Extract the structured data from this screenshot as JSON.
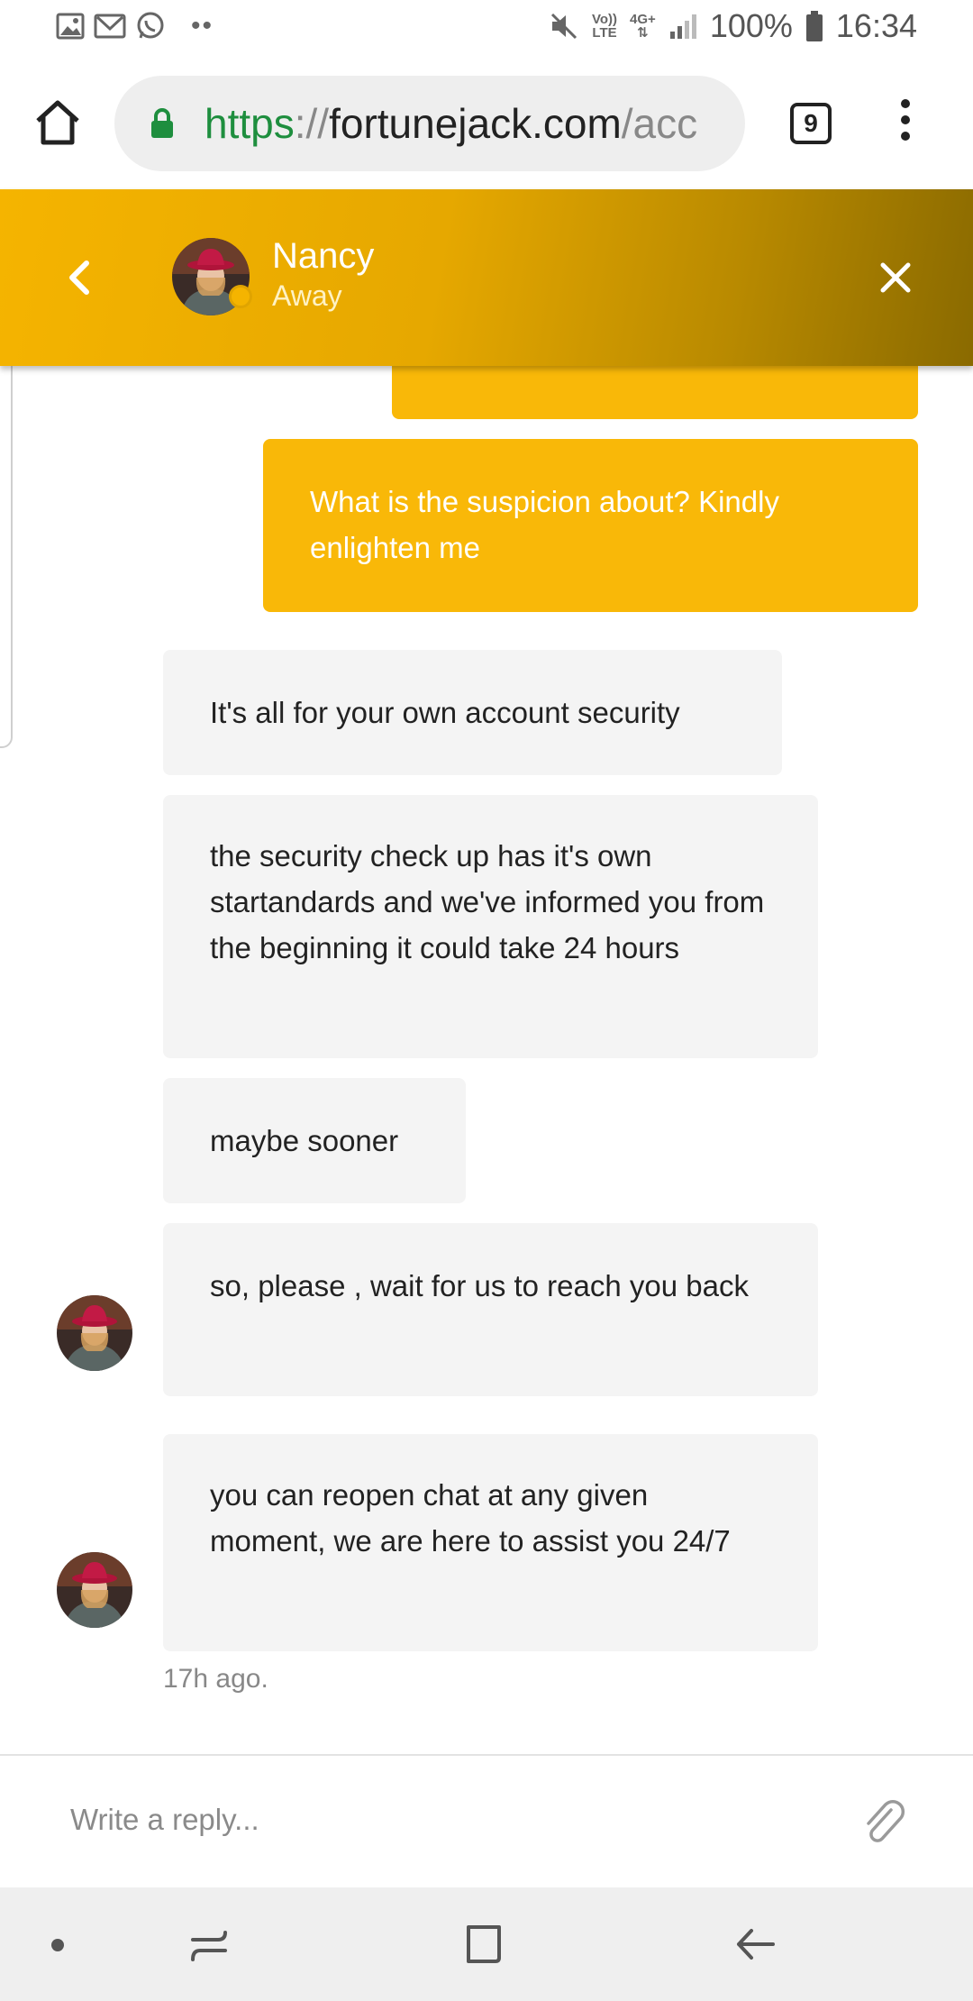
{
  "status_bar": {
    "left_icons": [
      "image-icon",
      "gmail-icon",
      "whatsapp-icon"
    ],
    "more_indicator": "••",
    "volte_top": "Vo))",
    "volte_bottom": "LTE",
    "network_type": "4G+",
    "battery": "100%",
    "time": "16:34"
  },
  "browser": {
    "url_scheme": "https",
    "url_sep": "://",
    "url_host": "fortunejack.com",
    "url_tail": "/acc",
    "tab_count": "9"
  },
  "chat_header": {
    "agent_name": "Nancy",
    "agent_status": "Away",
    "status_color": "#f5b400"
  },
  "messages": [
    {
      "from": "user",
      "text": ""
    },
    {
      "from": "user",
      "text": "What is the suspicion about? Kindly enlighten me"
    },
    {
      "from": "agent",
      "text": "It's all for your own account security"
    },
    {
      "from": "agent",
      "text": "the security check up has it's own startandards and we've informed you from the beginning it could take 24 hours"
    },
    {
      "from": "agent",
      "text": "maybe sooner"
    },
    {
      "from": "agent",
      "text": "so, please , wait for us to reach you back"
    },
    {
      "from": "agent",
      "text": "you can reopen chat at any given moment, we are here to assist you 24/7"
    }
  ],
  "timestamp": "17h ago.",
  "reply": {
    "placeholder": "Write a reply..."
  },
  "colors": {
    "brand": "#f9b808",
    "url_scheme": "#1e8e3e"
  }
}
